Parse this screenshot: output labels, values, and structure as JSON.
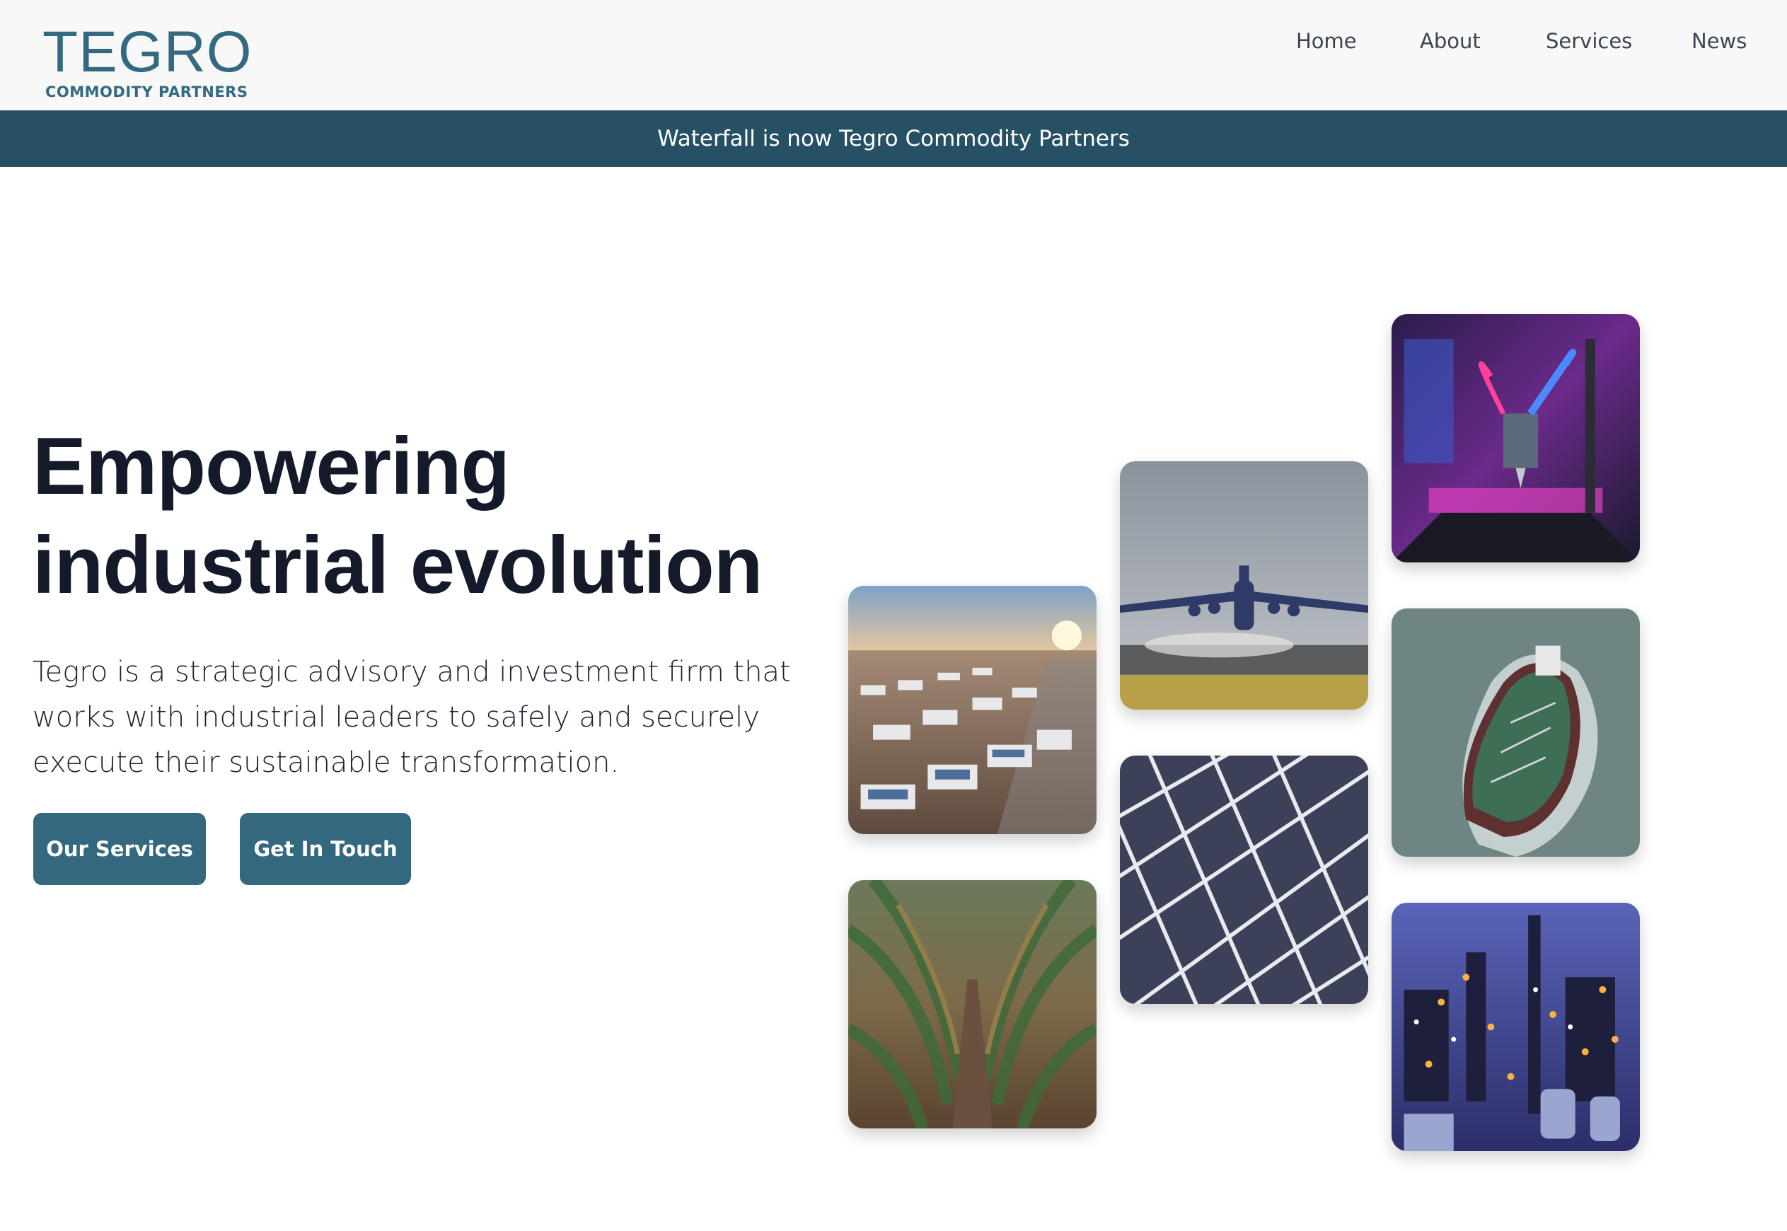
{
  "brand": {
    "name": "TEGRO",
    "subtitle": "COMMODITY PARTNERS",
    "color": "#336a80"
  },
  "nav": {
    "items": [
      {
        "label": "Home"
      },
      {
        "label": "About"
      },
      {
        "label": "Services"
      },
      {
        "label": "News"
      }
    ]
  },
  "banner": {
    "text": "Waterfall is now Tegro Commodity Partners",
    "color": "#265063"
  },
  "hero": {
    "title_line1": "Empowering",
    "title_line2": "industrial evolution",
    "description": "Tegro is a strategic advisory and investment firm that works with industrial leaders to safely and securely execute their sustainable transformation.",
    "buttons": {
      "services_label": "Our Services",
      "contact_label": "Get In Touch"
    },
    "button_color": "#33687e"
  },
  "gallery": {
    "images": [
      {
        "subject": "battery-storage-facility"
      },
      {
        "subject": "cornfield-rows"
      },
      {
        "subject": "airplane-takeoff"
      },
      {
        "subject": "solar-panel-closeup"
      },
      {
        "subject": "3d-printer"
      },
      {
        "subject": "oil-tanker-ship"
      },
      {
        "subject": "refinery-at-night"
      }
    ]
  }
}
